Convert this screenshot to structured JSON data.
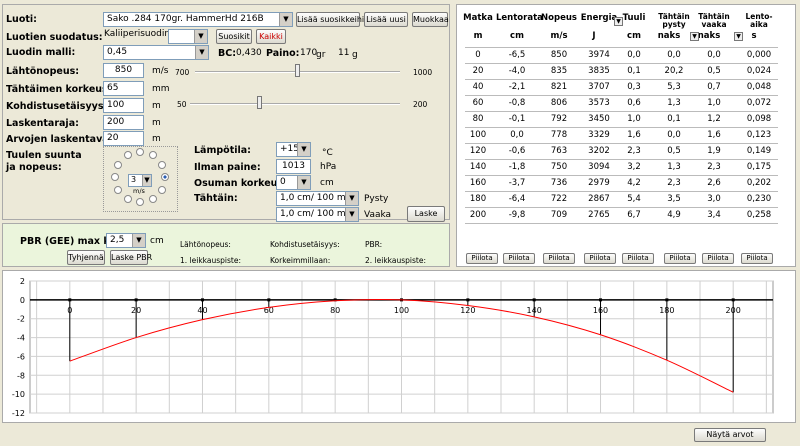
{
  "form": {
    "cartridge_label": "Luoti:",
    "cartridge_value": "Sako .284 170gr. HammerHd  216B",
    "add_favorite": "Lisää suosikkeihin",
    "add_new": "Lisää uusi",
    "edit": "Muokkaa",
    "filter_label": "Luotien suodatus:",
    "caliber_filter": "Kaliiperisuodin",
    "favorites": "Suosikit",
    "all": "Kaikki",
    "model_label": "Luodin malli:",
    "model_value": "0,45",
    "bc_label": "BC:",
    "bc_value": "0,430",
    "weight_label": "Paino:",
    "weight_value": "170",
    "weight_unit": "gr",
    "weight_grams": "11",
    "grams_unit": "g",
    "velocity_label": "Lähtönopeus:",
    "velocity_value": "850",
    "velocity_unit": "m/s",
    "velocity_min": "700",
    "velocity_max": "1000",
    "velocity_slider_fraction": 0.5,
    "sight_label": "Tähtäimen korkeus:",
    "sight_value": "65",
    "sight_unit": "mm",
    "zero_label": "Kohdistusetäisyys:",
    "zero_value": "100",
    "zero_unit": "m",
    "zero_min": "50",
    "zero_max": "200",
    "zero_slider_fraction": 0.333,
    "range_label": "Laskentaraja:",
    "range_value": "200",
    "range_unit": "m",
    "step_label": "Arvojen laskentaväli:",
    "step_value": "20",
    "step_unit": "m",
    "wind_label_1": "Tuulen suunta",
    "wind_label_2": "ja nopeus:",
    "wind_value": "3",
    "wind_unit": "m/s",
    "temp_label": "Lämpötila:",
    "temp_value": "+15",
    "temp_unit": "°C",
    "pressure_label": "Ilman paine:",
    "pressure_value": "1013",
    "pressure_unit": "hPa",
    "height_label": "Osuman korkeus:",
    "height_value": "0",
    "height_unit": "cm",
    "aim_label": "Tähtäin:",
    "aim_v_value": "1,0 cm/ 100 m",
    "aim_v_label": "Pysty",
    "aim_h_value": "1,0 cm/ 100 m",
    "aim_h_label": "Vaaka",
    "calculate": "Laske"
  },
  "pbr": {
    "label": "PBR (GEE) max koro:",
    "value": "2,5",
    "unit": "cm",
    "clear": "Tyhjennä",
    "calc": "Laske PBR",
    "velocity": "Lähtönopeus:",
    "zero": "Kohdistusetäisyys:",
    "pbr": "PBR:",
    "cross1": "1. leikkauspiste:",
    "highest": "Korkeimmillaan:",
    "cross2": "2. leikkauspiste:"
  },
  "table": {
    "headers": [
      "Matka",
      "Lentorata",
      "Nopeus",
      "Energia",
      "Tuuli",
      "Tähtäin pysty",
      "Tähtäin vaaka",
      "Lento-aika"
    ],
    "units": [
      "m",
      "cm",
      "m/s",
      "J",
      "cm",
      "naks",
      "naks",
      "s"
    ],
    "rows": [
      [
        "0",
        "-6,5",
        "850",
        "3974",
        "0,0",
        "0,0",
        "0,0",
        "0,000"
      ],
      [
        "20",
        "-4,0",
        "835",
        "3835",
        "0,1",
        "20,2",
        "0,5",
        "0,024"
      ],
      [
        "40",
        "-2,1",
        "821",
        "3707",
        "0,3",
        "5,3",
        "0,7",
        "0,048"
      ],
      [
        "60",
        "-0,8",
        "806",
        "3573",
        "0,6",
        "1,3",
        "1,0",
        "0,072"
      ],
      [
        "80",
        "-0,1",
        "792",
        "3450",
        "1,0",
        "0,1",
        "1,2",
        "0,098"
      ],
      [
        "100",
        "0,0",
        "778",
        "3329",
        "1,6",
        "0,0",
        "1,6",
        "0,123"
      ],
      [
        "120",
        "-0,6",
        "763",
        "3202",
        "2,3",
        "0,5",
        "1,9",
        "0,149"
      ],
      [
        "140",
        "-1,8",
        "750",
        "3094",
        "3,2",
        "1,3",
        "2,3",
        "0,175"
      ],
      [
        "160",
        "-3,7",
        "736",
        "2979",
        "4,2",
        "2,3",
        "2,6",
        "0,202"
      ],
      [
        "180",
        "-6,4",
        "722",
        "2867",
        "5,4",
        "3,5",
        "3,0",
        "0,230"
      ],
      [
        "200",
        "-9,8",
        "709",
        "2765",
        "6,7",
        "4,9",
        "3,4",
        "0,258"
      ]
    ],
    "hide": "Piilota"
  },
  "chart_data": {
    "type": "line",
    "x": [
      0,
      20,
      40,
      60,
      80,
      100,
      120,
      140,
      160,
      180,
      200
    ],
    "y": [
      -6.5,
      -4.0,
      -2.1,
      -0.8,
      -0.1,
      0.0,
      -0.6,
      -1.8,
      -3.7,
      -6.4,
      -9.8
    ],
    "xticks": [
      "0",
      "20",
      "40",
      "60",
      "80",
      "100",
      "120",
      "140",
      "160",
      "180",
      "200"
    ],
    "yticks": [
      "2",
      "0",
      "-2",
      "-4",
      "-6",
      "-8",
      "-10",
      "-12"
    ],
    "xlim": [
      -12,
      212
    ],
    "ylim": [
      -12,
      2
    ],
    "grid": true,
    "line_color": "#ff0000"
  },
  "footer": {
    "show_values": "Näytä arvot"
  }
}
